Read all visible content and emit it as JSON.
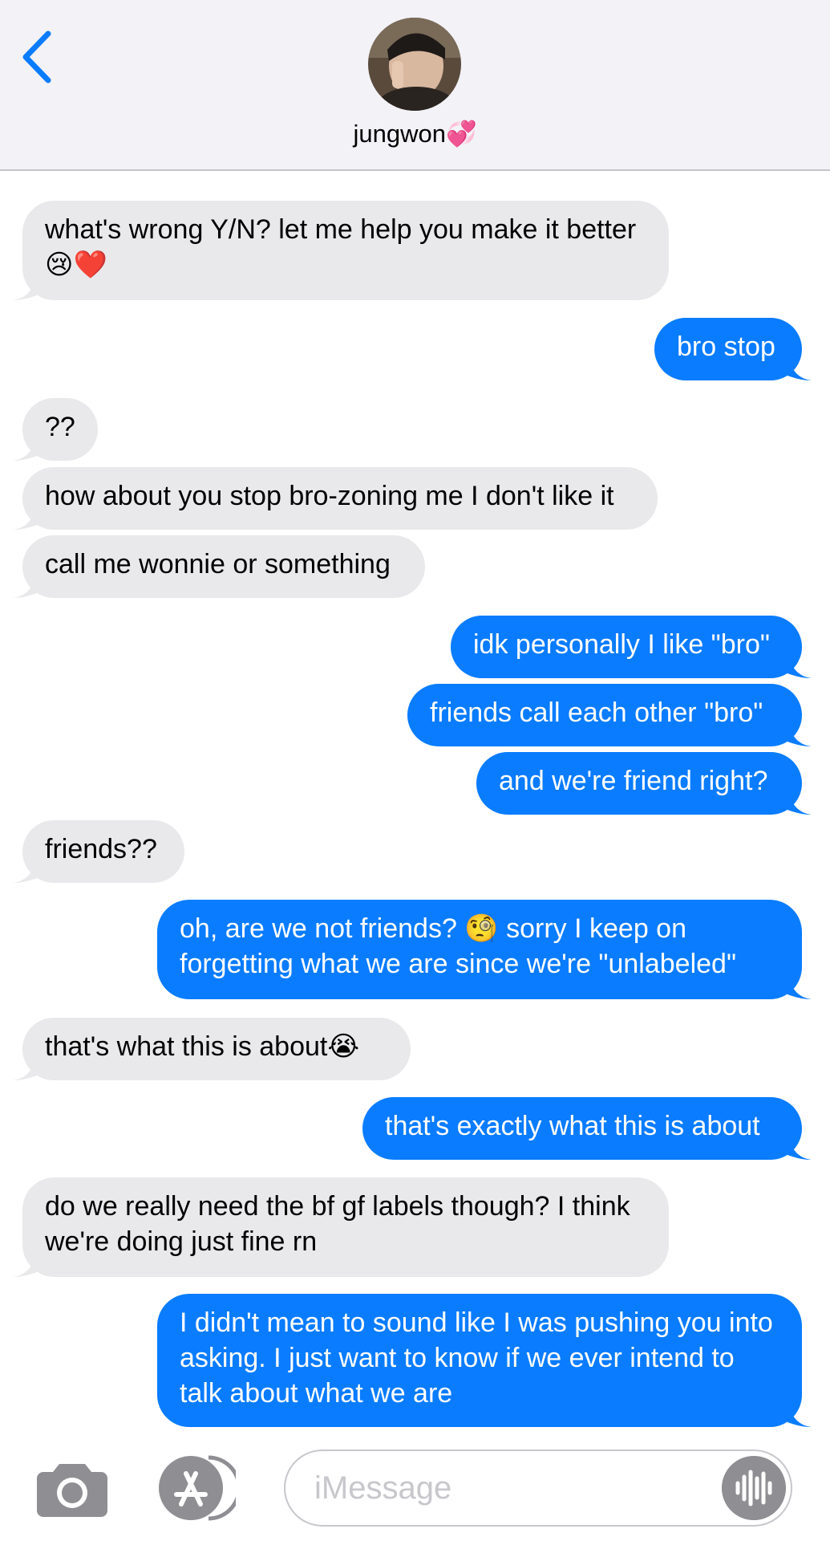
{
  "header": {
    "contact_name": "jungwon",
    "contact_emoji": "💞",
    "back_icon": "chevron-left-icon",
    "accent_color": "#0a7cff"
  },
  "messages": [
    {
      "dir": "in",
      "text": "what's wrong Y/N? let me help you make it better😢❤️"
    },
    {
      "dir": "out",
      "text": "bro stop"
    },
    {
      "dir": "in",
      "text": "??"
    },
    {
      "dir": "in",
      "text": "how about you stop bro-zoning me I don't like it"
    },
    {
      "dir": "in",
      "text": "call me wonnie or something"
    },
    {
      "dir": "out",
      "text": "idk personally I like \"bro\""
    },
    {
      "dir": "out",
      "text": "friends call each other \"bro\""
    },
    {
      "dir": "out",
      "text": "and we're friend right?"
    },
    {
      "dir": "in",
      "text": "friends??"
    },
    {
      "dir": "out",
      "text": "oh, are we not friends? 🧐 sorry I keep on forgetting what we are since we're \"unlabeled\""
    },
    {
      "dir": "in",
      "text": "that's what this is about😭"
    },
    {
      "dir": "out",
      "text": "that's exactly what this is about"
    },
    {
      "dir": "in",
      "text": "do we really need the bf gf labels though? I think we're doing just fine rn"
    },
    {
      "dir": "out",
      "text": "I didn't mean to sound like I was pushing you into asking. I just want to know if we ever intend to talk about what we are"
    }
  ],
  "composer": {
    "placeholder": "iMessage",
    "camera_icon": "camera-icon",
    "apps_icon": "app-store-icon",
    "audio_icon": "audio-waveform-icon"
  },
  "colors": {
    "incoming_bubble": "#e9e9eb",
    "outgoing_bubble": "#0a7cff",
    "header_bg": "#f2f2f7"
  }
}
